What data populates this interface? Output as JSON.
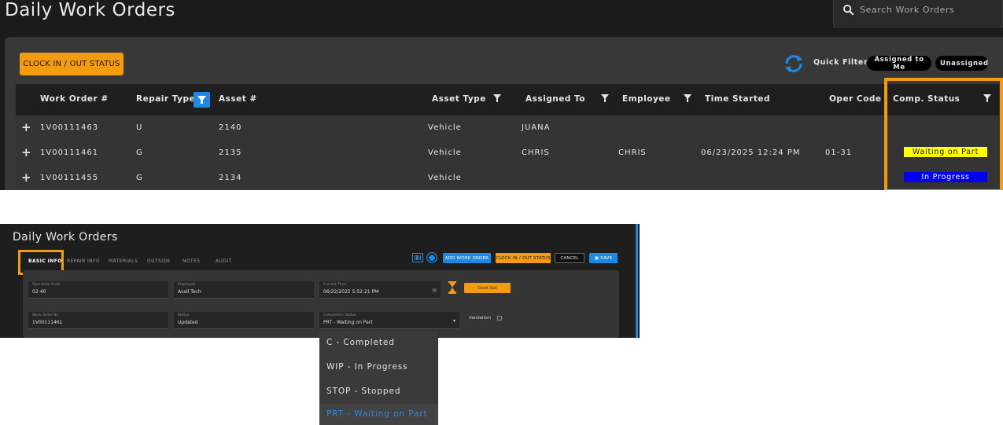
{
  "top": {
    "title": "Daily Work Orders",
    "search_placeholder": "Search Work Orders",
    "clock_button": "CLOCK IN / OUT STATUS",
    "quick_filter_label": "Quick Filter:",
    "quick_filters": [
      "Assigned to Me",
      "Unassigned"
    ],
    "columns": [
      "Work Order #",
      "Repair Type",
      "Asset #",
      "Asset Type",
      "Assigned To",
      "Employee",
      "Time Started",
      "Oper Code",
      "Comp. Status"
    ],
    "rows": [
      {
        "work_order": "1V00111463",
        "repair_type": "U",
        "asset": "2140",
        "asset_type": "Vehicle",
        "assigned_to": "JUANA",
        "employee": "",
        "time_started": "",
        "oper_code": "",
        "status": ""
      },
      {
        "work_order": "1V00111461",
        "repair_type": "G",
        "asset": "2135",
        "asset_type": "Vehicle",
        "assigned_to": "CHRIS",
        "employee": "CHRIS",
        "time_started": "06/23/2025 12:24 PM",
        "oper_code": "01-31",
        "status": "Waiting on Part"
      },
      {
        "work_order": "1V00111455",
        "repair_type": "G",
        "asset": "2134",
        "asset_type": "Vehicle",
        "assigned_to": "",
        "employee": "",
        "time_started": "",
        "oper_code": "",
        "status": "In Progress"
      }
    ],
    "status_colors": {
      "waiting": "#ffff00",
      "in_progress": "#0000ee"
    },
    "accent": "#f39c12",
    "filter_active_color": "#1e88e5"
  },
  "bottom": {
    "title": "Daily Work Orders",
    "tabs": [
      "BASIC INFO",
      "REPAIR INFO",
      "MATERIALS",
      "OUTSIDE",
      "NOTES",
      "AUDIT"
    ],
    "buttons": {
      "add": "ADD WORK ORDER",
      "clock": "CLOCK IN / OUT STATUS",
      "cancel": "CANCEL",
      "save": "SAVE"
    },
    "fields": {
      "operation_code": {
        "label": "Operation Code",
        "value": "02-40"
      },
      "employee": {
        "label": "Employee",
        "value": "Avail Tech"
      },
      "current_time": {
        "label": "Current Time",
        "value": "06/22/2025 5:52:21 PM"
      },
      "work_order_no": {
        "label": "Work Order No",
        "value": "1V00111461"
      },
      "status": {
        "label": "Status",
        "value": "Updated"
      },
      "completion_status": {
        "label": "Completion Status",
        "value": "PRT - Waiting on Part"
      }
    },
    "clock_out": "Clock Out",
    "vandalism": "Vandalism",
    "dropdown_options": [
      "C - Completed",
      "WIP - In Progress",
      "STOP - Stopped",
      "PRT - Waiting on Part"
    ]
  }
}
